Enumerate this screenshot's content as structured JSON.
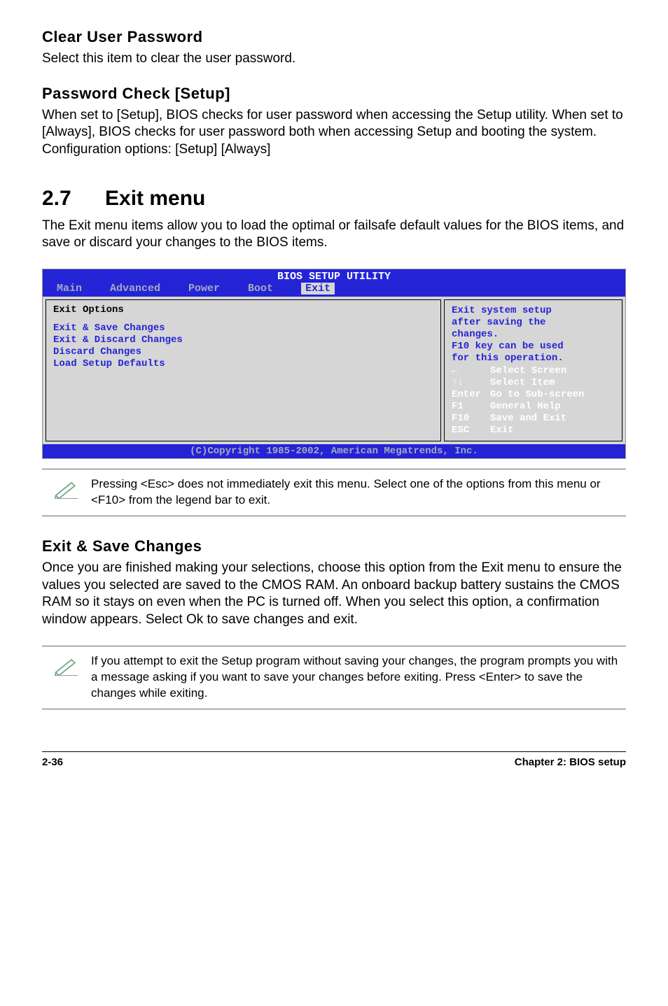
{
  "sec1": {
    "title": "Clear User Password",
    "body": "Select this item to clear the user password."
  },
  "sec2": {
    "title": "Password Check [Setup]",
    "body": "When set to [Setup], BIOS checks for user password when accessing the Setup utility. When set to [Always], BIOS checks for user password both when accessing Setup and booting the system.\nConfiguration options: [Setup] [Always]"
  },
  "main": {
    "number": "2.7",
    "title": "Exit menu",
    "intro": "The Exit menu items allow you to load the optimal or failsafe default values for the BIOS items, and save or discard your changes to the BIOS items."
  },
  "bios": {
    "header": "BIOS SETUP UTILITY",
    "tabs": [
      "Main",
      "Advanced",
      "Power",
      "Boot",
      "Exit"
    ],
    "active_tab_index": 4,
    "left": {
      "heading": "Exit Options",
      "items": [
        "Exit & Save Changes",
        "Exit & Discard Changes",
        "Discard Changes",
        "",
        "Load Setup Defaults"
      ]
    },
    "right": {
      "help": [
        "Exit system setup",
        "after saving the",
        "changes.",
        "",
        "F10 key can be used",
        "for this operation."
      ],
      "navRows": [
        {
          "key": "←",
          "desc": "Select Screen"
        },
        {
          "key": "↑↓",
          "desc": "Select Item"
        },
        {
          "key": "Enter",
          "desc": "Go to Sub-screen"
        },
        {
          "key": "F1",
          "desc": "General Help"
        },
        {
          "key": "F10",
          "desc": "Save and Exit"
        },
        {
          "key": "ESC",
          "desc": "Exit"
        }
      ]
    },
    "footer": "(C)Copyright 1985-2002, American Megatrends, Inc."
  },
  "note1": "Pressing <Esc> does not immediately exit this menu. Select one of the options from this menu or <F10> from the legend bar to exit.",
  "sec3": {
    "title": "Exit & Save Changes",
    "body": "Once you are finished making your selections, choose this option from the Exit menu to ensure the values you selected are saved to the CMOS RAM. An onboard backup battery sustains the CMOS RAM so it stays on even when the PC is turned off. When you select this option, a confirmation window appears. Select Ok to save changes and exit."
  },
  "note2": "If you attempt to exit the Setup program without saving your changes, the program prompts you with a message asking if you want to save your changes before exiting. Press <Enter>  to save the  changes while exiting.",
  "footer": {
    "left": "2-36",
    "right": "Chapter 2: BIOS setup"
  }
}
